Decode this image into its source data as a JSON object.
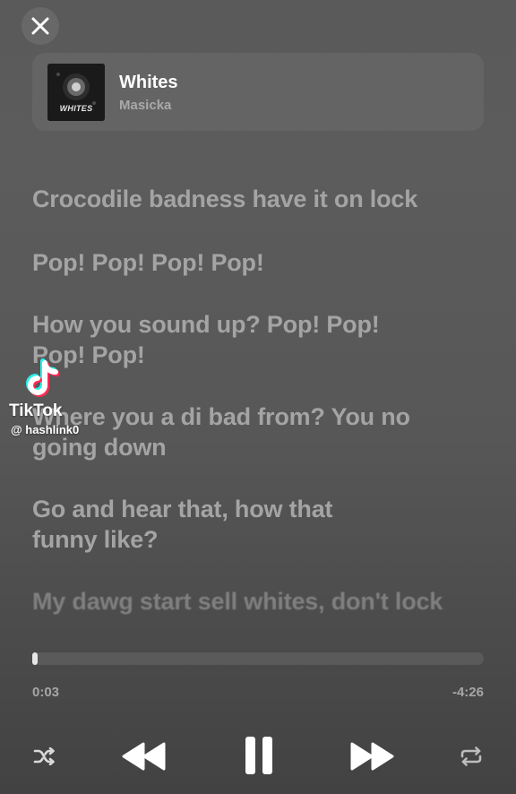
{
  "header": {
    "close_icon": "close-icon"
  },
  "now_playing": {
    "title": "Whites",
    "artist": "Masicka",
    "artwork_text": "WHITES"
  },
  "lyrics": [
    "Crocodile badness have it on lock",
    "Pop! Pop! Pop! Pop!",
    "How you sound up? Pop! Pop!",
    "Pop! Pop!",
    "Where you a di bad from? You no",
    "going down",
    "Go and hear that, how that",
    "funny like?",
    "My dawg start sell whites, don't lock"
  ],
  "watermark": {
    "name": "TikTok",
    "handle": "@ hashlink0"
  },
  "player": {
    "elapsed": "0:03",
    "remaining": "-4:26",
    "progress_fraction": 0.011,
    "controls": [
      "shuffle-icon",
      "previous-icon",
      "pause-icon",
      "next-icon",
      "repeat-icon"
    ]
  },
  "colors": {
    "background": "#575757",
    "lyric": "#a4a4a4",
    "accent": "#ffffff"
  }
}
